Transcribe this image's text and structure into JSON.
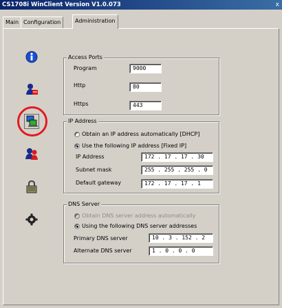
{
  "window": {
    "title": "CS1708i WinClient Version V1.0.073",
    "close_glyph": "x"
  },
  "tabs": [
    {
      "label": "Main",
      "active": false
    },
    {
      "label": "Configuration",
      "active": false
    },
    {
      "label": "Administration",
      "active": true
    }
  ],
  "sidebar": {
    "icons": [
      {
        "name": "info-icon"
      },
      {
        "name": "user-icon"
      },
      {
        "name": "network-icon",
        "highlighted": true
      },
      {
        "name": "users-icon"
      },
      {
        "name": "lock-icon"
      },
      {
        "name": "gear-icon"
      }
    ]
  },
  "access_ports": {
    "legend": "Access Ports",
    "program": {
      "label": "Program",
      "value": "9000"
    },
    "http": {
      "label": "Http",
      "value": "80"
    },
    "https": {
      "label": "Https",
      "value": "443"
    }
  },
  "ip_address": {
    "legend": "IP Address",
    "dhcp_option": {
      "label": "Obtain an IP address automatically [DHCP]",
      "selected": false
    },
    "fixed_option": {
      "label": "Use the following IP address [Fixed IP]",
      "selected": true
    },
    "ip": {
      "label": "IP Address",
      "value": "172 . 17 . 17 . 30"
    },
    "subnet": {
      "label": "Subnet mask",
      "value": "255 . 255 . 255 . 0"
    },
    "gateway": {
      "label": "Default gateway",
      "value": "172 . 17 . 17 . 1"
    }
  },
  "dns_server": {
    "legend": "DNS Server",
    "auto_option": {
      "label": "Obtain DNS server address automatically",
      "selected": false,
      "disabled": true
    },
    "manual_option": {
      "label": "Using the following DNS server addresses",
      "selected": true
    },
    "primary": {
      "label": "Primary DNS server",
      "value": "10 . 3 . 152 . 2"
    },
    "alternate": {
      "label": "Alternate DNS server",
      "value": "1 . 0 . 0 . 0"
    }
  },
  "colors": {
    "titlebar": "#0a246a",
    "panel": "#d4d0c8",
    "highlight_ring": "#e11b22"
  }
}
